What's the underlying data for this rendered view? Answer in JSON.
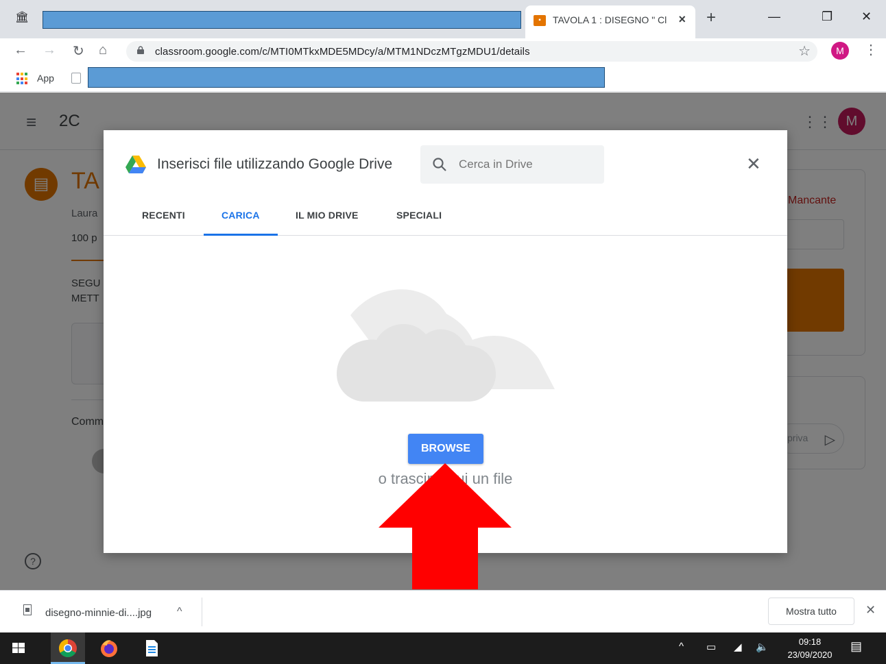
{
  "browser": {
    "active_tab_title": "TAVOLA 1 : DISEGNO \" Cl",
    "url": "classroom.google.com/c/MTI0MTkxMDE5MDcy/a/MTM1NDczMTgzMDU1/details",
    "profile_initial": "M"
  },
  "bookmarks": {
    "apps_label": "App"
  },
  "classroom": {
    "class_name": "2C",
    "avatar_initial": "M",
    "assignment_title_partial": "TA",
    "teacher_partial": "Laura",
    "points_partial": "100 p",
    "description_line1": "SEGU",
    "description_line2": "METT",
    "comments_partial": "Comm",
    "status_partial": "Mancante",
    "private_partial": "priva"
  },
  "dialog": {
    "title": "Inserisci file utilizzando Google Drive",
    "search_placeholder": "Cerca in Drive",
    "tabs": [
      "RECENTI",
      "CARICA",
      "IL MIO DRIVE",
      "SPECIALI"
    ],
    "active_tab": "CARICA",
    "browse_label": "BROWSE",
    "drag_text": "o trascina qui un file"
  },
  "download_bar": {
    "file_name": "disegno-minnie-di....jpg",
    "show_all_label": "Mostra tutto"
  },
  "taskbar": {
    "time": "09:18",
    "date": "23/09/2020"
  },
  "colors": {
    "accent_blue": "#1a73e8",
    "browse_blue": "#4285f4",
    "classroom_orange": "#e37400",
    "annotation_red": "#ff0000"
  }
}
